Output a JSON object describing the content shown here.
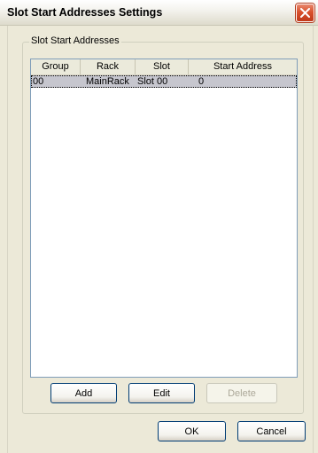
{
  "window": {
    "title": "Slot Start Addresses Settings"
  },
  "group": {
    "label": "Slot Start Addresses"
  },
  "table": {
    "columns": [
      "Group",
      "Rack",
      "Slot",
      "Start Address"
    ],
    "rows": [
      {
        "group": "00",
        "rack": "MainRack",
        "slot": "Slot 00",
        "start_address": "0"
      }
    ]
  },
  "buttons": {
    "add": "Add",
    "edit": "Edit",
    "delete": "Delete",
    "ok": "OK",
    "cancel": "Cancel"
  },
  "icons": {
    "close": "close-icon"
  }
}
